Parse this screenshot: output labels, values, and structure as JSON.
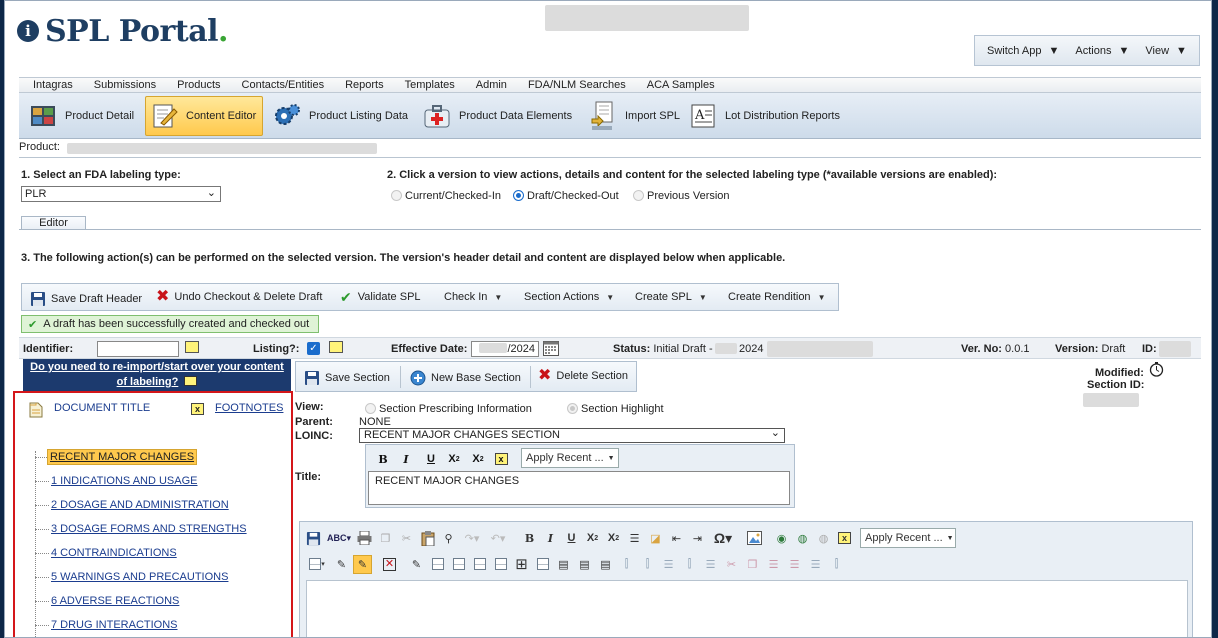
{
  "header": {
    "logo_text": "SPL Portal",
    "logo_dot": ".",
    "menu": {
      "switch_app": "Switch App",
      "actions": "Actions",
      "view": "View"
    }
  },
  "menubar": [
    "Intagras",
    "Submissions",
    "Products",
    "Contacts/Entities",
    "Reports",
    "Templates",
    "Admin",
    "FDA/NLM Searches",
    "ACA Samples"
  ],
  "toolbar": {
    "product_detail": "Product Detail",
    "content_editor": "Content Editor",
    "product_listing_data": "Product Listing Data",
    "product_data_elements": "Product Data Elements",
    "import_spl": "Import SPL",
    "lot_distribution_reports": "Lot Distribution Reports"
  },
  "product_label": "Product:",
  "step1": {
    "label": "1. Select an FDA labeling type:",
    "selected": "PLR"
  },
  "step2": {
    "label": "2. Click a version to view actions, details and content for the selected labeling type (*available versions are enabled):",
    "options": [
      "Current/Checked-In",
      "Draft/Checked-Out",
      "Previous Version"
    ]
  },
  "tab_editor": "Editor",
  "step3": "3. The following action(s) can be performed on the selected version. The version's header detail and content are displayed below when applicable.",
  "actions": {
    "save_draft_header": "Save Draft Header",
    "undo_checkout": "Undo Checkout & Delete Draft",
    "validate_spl": "Validate SPL",
    "check_in": "Check In",
    "section_actions": "Section Actions",
    "create_spl": "Create SPL",
    "create_rendition": "Create Rendition"
  },
  "success_message": "A draft has been successfully created and checked out",
  "info": {
    "identifier_label": "Identifier:",
    "listing_label": "Listing?:",
    "effective_date_label": "Effective Date:",
    "effective_date_value": "/2024",
    "status_label": "Status:",
    "status_value": "Initial Draft -",
    "status_year": "2024",
    "ver_no_label": "Ver. No:",
    "ver_no_value": "0.0.1",
    "version_label": "Version:",
    "version_value": "Draft",
    "id_label": "ID:"
  },
  "reimport": {
    "line1": "Do you need to re-import/start over your content",
    "line2": "of labeling?"
  },
  "tree": {
    "document_title": "DOCUMENT TITLE",
    "footnotes": "FOOTNOTES",
    "items": [
      "RECENT MAJOR CHANGES",
      "1 INDICATIONS AND USAGE",
      "2 DOSAGE AND ADMINISTRATION",
      "3 DOSAGE FORMS AND STRENGTHS",
      "4 CONTRAINDICATIONS",
      "5 WARNINGS AND PRECAUTIONS",
      "6 ADVERSE REACTIONS",
      "7 DRUG INTERACTIONS"
    ]
  },
  "section": {
    "save_section": "Save Section",
    "new_base_section": "New Base Section",
    "delete_section": "Delete Section",
    "modified_label": "Modified:",
    "section_id_label": "Section ID:",
    "view_label": "View:",
    "view_options": [
      "Section Prescribing Information",
      "Section Highlight"
    ],
    "parent_label": "Parent:",
    "parent_value": "NONE",
    "loinc_label": "LOINC:",
    "loinc_value": "RECENT MAJOR CHANGES SECTION",
    "title_label": "Title:",
    "title_value": "RECENT MAJOR CHANGES",
    "apply_recent": "Apply Recent ..."
  },
  "colors": {
    "brand_navy": "#1e3e62",
    "accent_green": "#3aa535",
    "highlight_red": "#d4161a"
  }
}
